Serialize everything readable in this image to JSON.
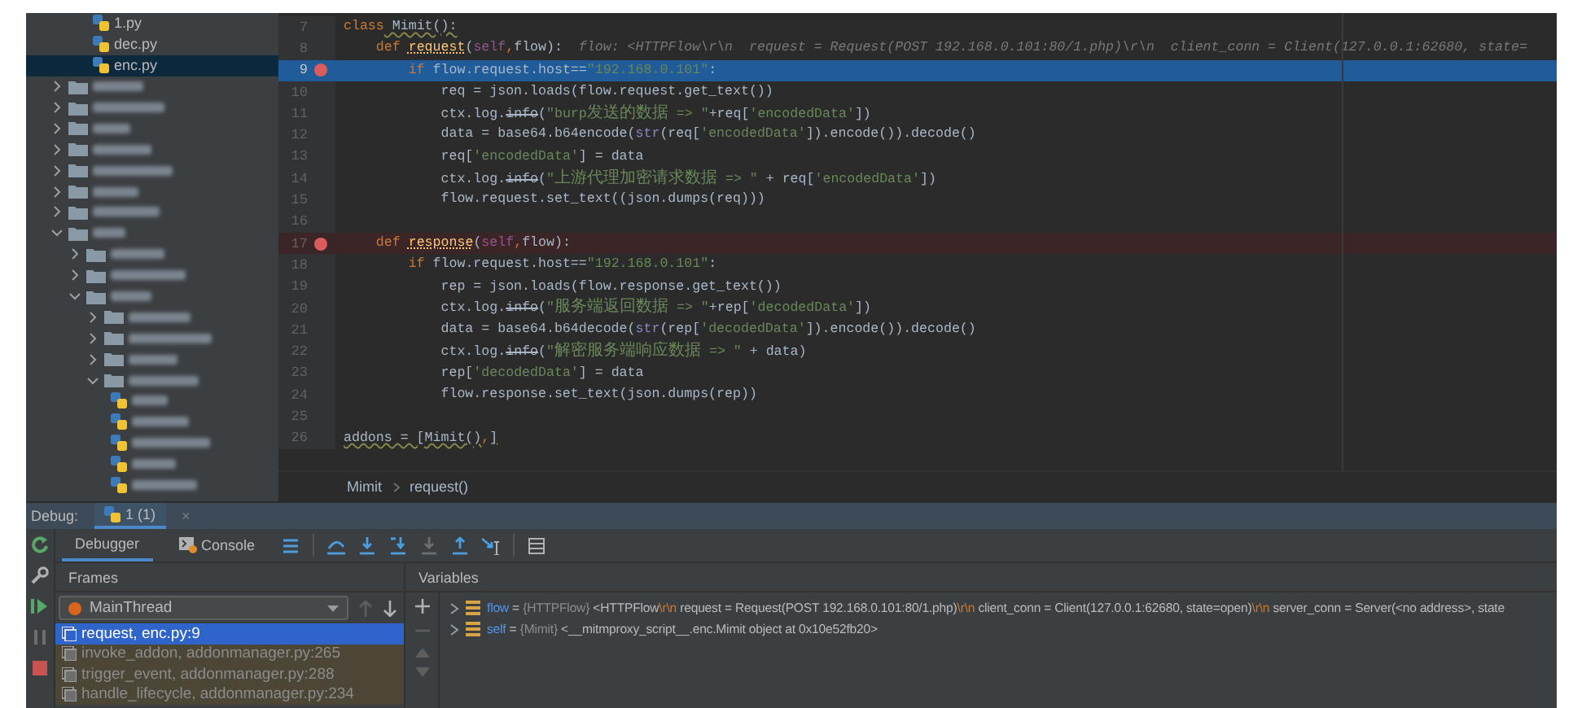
{
  "project": {
    "files_tail": [
      {
        "kind": "file",
        "label": "1.py",
        "selected": false
      },
      {
        "kind": "file",
        "label": "dec.py",
        "selected": false
      },
      {
        "kind": "file",
        "label": "enc.py",
        "selected": true
      }
    ],
    "items": [
      {
        "kind": "hidden_folder",
        "expanded": false,
        "selected": false
      },
      {
        "kind": "hidden_folder",
        "expanded": false,
        "selected": false
      },
      {
        "kind": "hidden_folder",
        "expanded": false,
        "selected": false
      },
      {
        "kind": "hidden_folder",
        "expanded": false,
        "selected": false
      },
      {
        "kind": "hidden_folder",
        "expanded": false,
        "selected": false
      },
      {
        "kind": "hidden_folder",
        "expanded": false,
        "selected": false
      },
      {
        "kind": "hidden_folder",
        "expanded": false,
        "selected": false
      },
      {
        "kind": "hidden_folder",
        "expanded": true,
        "selected": false,
        "children": [
          {
            "kind": "hidden_folder",
            "expanded": false,
            "selected": false
          },
          {
            "kind": "hidden_folder",
            "expanded": false,
            "selected": false
          },
          {
            "kind": "hidden_folder",
            "expanded": true,
            "selected": false,
            "children": [
              {
                "kind": "hidden_folder",
                "expanded": false,
                "selected": false
              },
              {
                "kind": "hidden_folder",
                "expanded": false,
                "selected": false
              },
              {
                "kind": "hidden_folder",
                "expanded": false,
                "selected": false
              },
              {
                "kind": "hidden_folder",
                "expanded": true,
                "selected": false,
                "children": [
                  {
                    "kind": "hidden_file",
                    "selected": false
                  },
                  {
                    "kind": "hidden_file",
                    "selected": false
                  },
                  {
                    "kind": "hidden_file",
                    "selected": false
                  },
                  {
                    "kind": "hidden_file",
                    "selected": false
                  },
                  {
                    "kind": "hidden_file",
                    "selected": false
                  }
                ]
              }
            ]
          }
        ]
      }
    ]
  },
  "editor": {
    "lines": [
      {
        "number": "7",
        "current": false,
        "breakpoint": false,
        "tokens": [
          {
            "kind": "kw",
            "text": "class"
          },
          {
            "kind": "warn",
            "text": " Mimit():"
          }
        ]
      },
      {
        "number": "8",
        "current": false,
        "breakpoint": false,
        "tokens": [
          {
            "kind": "kw",
            "text": "    def "
          },
          {
            "kind": "fn",
            "text": "request"
          },
          {
            "kind": "plain",
            "text": "("
          },
          {
            "kind": "self",
            "text": "self"
          },
          {
            "kind": "kw",
            "text": ","
          },
          {
            "kind": "plain",
            "text": "flow):"
          },
          {
            "kind": "hint",
            "text": "  flow: <HTTPFlow\\r\\n  request = Request(POST 192.168.0.101:80/1.php)\\r\\n  client_conn = Client(127.0.0.1:62680, state="
          }
        ]
      },
      {
        "number": "9",
        "current": true,
        "breakpoint": true,
        "tokens": [
          {
            "kind": "kw",
            "text": "        if"
          },
          {
            "kind": "plain",
            "text": " flow.request.host=="
          },
          {
            "kind": "str",
            "text": "\"192.168.0.101\""
          },
          {
            "kind": "plain",
            "text": ":"
          }
        ]
      },
      {
        "number": "10",
        "current": false,
        "breakpoint": false,
        "tokens": [
          {
            "kind": "plain",
            "text": "            req = json.loads(flow.request.get_text())"
          }
        ]
      },
      {
        "number": "11",
        "current": false,
        "breakpoint": false,
        "tokens": [
          {
            "kind": "plain",
            "text": "            ctx.log."
          },
          {
            "kind": "deprecated",
            "text": "info"
          },
          {
            "kind": "plain",
            "text": "("
          },
          {
            "kind": "str",
            "text": "\"burp发送的数据 => \""
          },
          {
            "kind": "plain",
            "text": "+req["
          },
          {
            "kind": "str",
            "text": "'encodedData'"
          },
          {
            "kind": "plain",
            "text": "])"
          }
        ]
      },
      {
        "number": "12",
        "current": false,
        "breakpoint": false,
        "tokens": [
          {
            "kind": "plain",
            "text": "            data = base64.b64encode("
          },
          {
            "kind": "builtin",
            "text": "str"
          },
          {
            "kind": "plain",
            "text": "(req["
          },
          {
            "kind": "str",
            "text": "'encodedData'"
          },
          {
            "kind": "plain",
            "text": "]).encode()).decode()"
          }
        ]
      },
      {
        "number": "13",
        "current": false,
        "breakpoint": false,
        "tokens": [
          {
            "kind": "plain",
            "text": "            req["
          },
          {
            "kind": "str",
            "text": "'encodedData'"
          },
          {
            "kind": "plain",
            "text": "] = data"
          }
        ]
      },
      {
        "number": "14",
        "current": false,
        "breakpoint": false,
        "tokens": [
          {
            "kind": "plain",
            "text": "            ctx.log."
          },
          {
            "kind": "deprecated",
            "text": "info"
          },
          {
            "kind": "plain",
            "text": "("
          },
          {
            "kind": "str",
            "text": "\"上游代理加密请求数据 => \""
          },
          {
            "kind": "plain",
            "text": " + req["
          },
          {
            "kind": "str",
            "text": "'encodedData'"
          },
          {
            "kind": "plain",
            "text": "])"
          }
        ]
      },
      {
        "number": "15",
        "current": false,
        "breakpoint": false,
        "tokens": [
          {
            "kind": "plain",
            "text": "            flow.request.set_text((json.dumps(req)))"
          }
        ]
      },
      {
        "number": "16",
        "current": false,
        "breakpoint": false
      },
      {
        "number": "17",
        "current": false,
        "breakpoint": true,
        "tokens": [
          {
            "kind": "kw",
            "text": "    def "
          },
          {
            "kind": "fn",
            "text": "response"
          },
          {
            "kind": "plain",
            "text": "("
          },
          {
            "kind": "self",
            "text": "self"
          },
          {
            "kind": "kw",
            "text": ","
          },
          {
            "kind": "plain",
            "text": "flow):"
          }
        ]
      },
      {
        "number": "18",
        "current": false,
        "breakpoint": false,
        "tokens": [
          {
            "kind": "kw",
            "text": "        if"
          },
          {
            "kind": "plain",
            "text": " flow.request.host=="
          },
          {
            "kind": "str",
            "text": "\"192.168.0.101\""
          },
          {
            "kind": "plain",
            "text": ":"
          }
        ]
      },
      {
        "number": "19",
        "current": false,
        "breakpoint": false,
        "tokens": [
          {
            "kind": "plain",
            "text": "            rep = json.loads(flow.response.get_text())"
          }
        ]
      },
      {
        "number": "20",
        "current": false,
        "breakpoint": false,
        "tokens": [
          {
            "kind": "plain",
            "text": "            ctx.log."
          },
          {
            "kind": "deprecated",
            "text": "info"
          },
          {
            "kind": "plain",
            "text": "("
          },
          {
            "kind": "str",
            "text": "\"服务端返回数据 => \""
          },
          {
            "kind": "plain",
            "text": "+rep["
          },
          {
            "kind": "str",
            "text": "'decodedData'"
          },
          {
            "kind": "plain",
            "text": "])"
          }
        ]
      },
      {
        "number": "21",
        "current": false,
        "breakpoint": false,
        "tokens": [
          {
            "kind": "plain",
            "text": "            data = base64.b64decode("
          },
          {
            "kind": "builtin",
            "text": "str"
          },
          {
            "kind": "plain",
            "text": "(rep["
          },
          {
            "kind": "str",
            "text": "'decodedData'"
          },
          {
            "kind": "plain",
            "text": "]).encode()).decode()"
          }
        ]
      },
      {
        "number": "22",
        "current": false,
        "breakpoint": false,
        "tokens": [
          {
            "kind": "plain",
            "text": "            ctx.log."
          },
          {
            "kind": "deprecated",
            "text": "info"
          },
          {
            "kind": "plain",
            "text": "("
          },
          {
            "kind": "str",
            "text": "\"解密服务端响应数据 => \""
          },
          {
            "kind": "plain",
            "text": " + data)"
          }
        ]
      },
      {
        "number": "23",
        "current": false,
        "breakpoint": false,
        "tokens": [
          {
            "kind": "plain",
            "text": "            rep["
          },
          {
            "kind": "str",
            "text": "'decodedData'"
          },
          {
            "kind": "plain",
            "text": "] = data"
          }
        ]
      },
      {
        "number": "24",
        "current": false,
        "breakpoint": false,
        "tokens": [
          {
            "kind": "plain",
            "text": "            flow.response.set_text(json.dumps(rep))"
          }
        ]
      },
      {
        "number": "25",
        "current": false,
        "breakpoint": false
      },
      {
        "number": "26",
        "current": false,
        "breakpoint": false,
        "tokens": [
          {
            "kind": "warn",
            "text": "addons = [Mimit()"
          },
          {
            "kind": "kw",
            "text": ","
          },
          {
            "kind": "warn",
            "text": "]"
          }
        ]
      }
    ],
    "breadcrumb": [
      "Mimit",
      "request()"
    ]
  },
  "debug": {
    "label": "Debug:",
    "session": {
      "label": "1 (1)",
      "close": "×",
      "selected": true
    },
    "tabs": [
      {
        "label": "Debugger",
        "selected": true
      },
      {
        "label": "Console",
        "selected": false
      }
    ],
    "frames_header": "Frames",
    "variables_header": "Variables",
    "thread": {
      "name": "MainThread"
    },
    "frames": [
      {
        "label": "request, enc.py:9",
        "selected": true,
        "library": false
      },
      {
        "label": "invoke_addon, addonmanager.py:265",
        "selected": false,
        "library": true
      },
      {
        "label": "trigger_event, addonmanager.py:288",
        "selected": false,
        "library": true
      },
      {
        "label": "handle_lifecycle, addonmanager.py:234",
        "selected": false,
        "library": true
      }
    ],
    "variables": [
      {
        "name": "flow",
        "equals": "=",
        "type": "{HTTPFlow}",
        "expanded": false,
        "value": [
          {
            "kind": "text",
            "text": "<HTTPFlow"
          },
          {
            "kind": "escape",
            "text": "\\r\\n"
          },
          {
            "kind": "text",
            "text": " request = Request(POST 192.168.0.101:80/1.php)"
          },
          {
            "kind": "escape",
            "text": "\\r\\n"
          },
          {
            "kind": "text",
            "text": " client_conn = Client(127.0.0.1:62680, state=open)"
          },
          {
            "kind": "escape",
            "text": "\\r\\n"
          },
          {
            "kind": "text",
            "text": " server_conn = Server(<no address>, state"
          }
        ]
      },
      {
        "name": "self",
        "equals": "=",
        "type": "{Mimit}",
        "expanded": false,
        "value": [
          {
            "kind": "text",
            "text": "<__mitmproxy_script__.enc.Mimit object at 0x10e52fb20>"
          }
        ]
      }
    ]
  }
}
